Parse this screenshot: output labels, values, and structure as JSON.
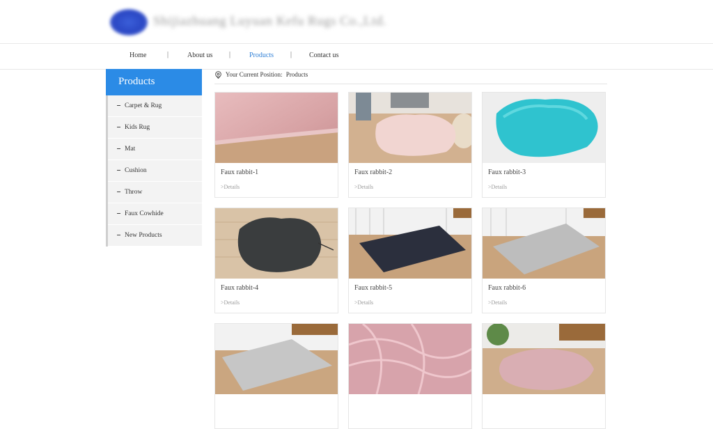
{
  "header": {
    "logo_text": "Shijiazhuang Luyuan Kefu Rugs Co.,Ltd."
  },
  "nav": {
    "items": [
      {
        "label": "Home"
      },
      {
        "label": "About us"
      },
      {
        "label": "Products",
        "active": true
      },
      {
        "label": "Contact us"
      }
    ],
    "separator": "|",
    "active_color": "#2f7fd6"
  },
  "sidebar": {
    "title": "Products",
    "title_bg": "#2b8be6",
    "items": [
      {
        "label": "Carpet & Rug"
      },
      {
        "label": "Kids Rug"
      },
      {
        "label": "Mat"
      },
      {
        "label": "Cushion"
      },
      {
        "label": "Throw"
      },
      {
        "label": "Faux Cowhide"
      },
      {
        "label": "New Products"
      }
    ]
  },
  "breadcrumb": {
    "icon": "location-pin-icon",
    "prefix": "Your Current Position:",
    "current": "Products"
  },
  "products": [
    {
      "name": "Faux rabbit-1",
      "details": ">Details"
    },
    {
      "name": "Faux rabbit-2",
      "details": ">Details"
    },
    {
      "name": "Faux rabbit-3",
      "details": ">Details"
    },
    {
      "name": "Faux rabbit-4",
      "details": ">Details"
    },
    {
      "name": "Faux rabbit-5",
      "details": ">Details"
    },
    {
      "name": "Faux rabbit-6",
      "details": ">Details"
    },
    {
      "name": "",
      "details": ""
    },
    {
      "name": "",
      "details": ""
    },
    {
      "name": "",
      "details": ""
    }
  ]
}
